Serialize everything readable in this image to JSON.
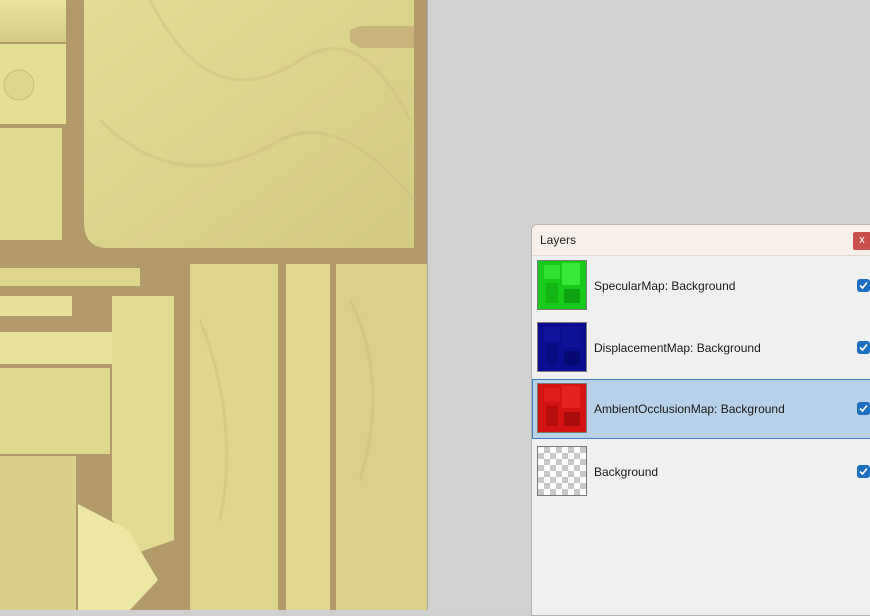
{
  "layers_panel": {
    "title": "Layers",
    "close_label": "x",
    "items": [
      {
        "label": "SpecularMap: Background",
        "thumb_color": "#17c91a",
        "visible": true,
        "selected": false
      },
      {
        "label": "DisplacementMap: Background",
        "thumb_color": "#0b0c8f",
        "visible": true,
        "selected": false
      },
      {
        "label": "AmbientOcclusionMap: Background",
        "thumb_color": "#d41313",
        "visible": true,
        "selected": true
      },
      {
        "label": "Background",
        "thumb_color": "transparent",
        "visible": true,
        "selected": false
      }
    ]
  },
  "colors": {
    "texture_base": "#d9d38a",
    "texture_seam": "#b39a6b",
    "selection": "#b6d1e8",
    "checkbox": "#1f6fc1"
  }
}
